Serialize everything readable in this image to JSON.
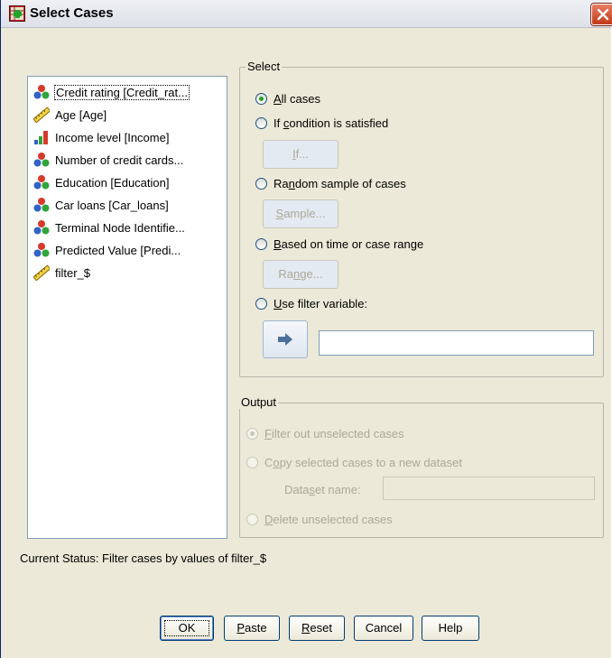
{
  "window": {
    "title": "Select Cases"
  },
  "variables": [
    {
      "label": "Credit rating [Credit_rat...",
      "icon": "nominal-icon",
      "selected": true
    },
    {
      "label": "Age [Age]",
      "icon": "scale-ruler-icon"
    },
    {
      "label": "Income level [Income]",
      "icon": "ordinal-bar-icon"
    },
    {
      "label": "Number of credit cards...",
      "icon": "nominal-icon"
    },
    {
      "label": "Education [Education]",
      "icon": "nominal-icon"
    },
    {
      "label": "Car loans [Car_loans]",
      "icon": "nominal-icon"
    },
    {
      "label": "Terminal Node Identifie...",
      "icon": "nominal-icon"
    },
    {
      "label": "Predicted Value [Predi...",
      "icon": "nominal-icon"
    },
    {
      "label": "filter_$",
      "icon": "scale-ruler-icon"
    }
  ],
  "select_group": {
    "legend": "Select",
    "all_cases": {
      "mnemonic": "A",
      "rest": "ll cases",
      "checked": true
    },
    "if_condition": {
      "pre": "If ",
      "mnemonic": "c",
      "rest": "ondition is satisfied"
    },
    "if_button": {
      "pre": "",
      "mnemonic": "I",
      "rest": "f..."
    },
    "random_sample": {
      "pre": "Ra",
      "mnemonic": "n",
      "rest": "dom sample of cases"
    },
    "sample_button": {
      "pre": "",
      "mnemonic": "S",
      "rest": "ample..."
    },
    "time_range": {
      "pre": "",
      "mnemonic": "B",
      "rest": "ased on time or case range"
    },
    "range_button": {
      "pre": "Ra",
      "mnemonic": "n",
      "rest": "ge..."
    },
    "filter_variable": {
      "pre": "",
      "mnemonic": "U",
      "rest": "se filter variable:"
    },
    "filter_value": ""
  },
  "output_group": {
    "legend": "Output",
    "filter_out": {
      "pre": "",
      "mnemonic": "F",
      "rest": "ilter out unselected cases",
      "checked": true
    },
    "copy_selected": {
      "pre": "C",
      "mnemonic": "o",
      "rest": "py selected cases to a new dataset"
    },
    "dataset_name": {
      "pre": "Data",
      "mnemonic": "s",
      "rest": "et name:",
      "value": ""
    },
    "delete_unselected": {
      "pre": "",
      "mnemonic": "D",
      "rest": "elete unselected cases"
    }
  },
  "status": "Current Status: Filter cases by values of filter_$",
  "buttons": {
    "ok": "OK",
    "paste": {
      "mnemonic": "P",
      "rest": "aste"
    },
    "reset": {
      "mnemonic": "R",
      "rest": "eset"
    },
    "cancel": "Cancel",
    "help": "Help"
  },
  "colors": {
    "selected_radio": "#21a121",
    "dialog_bg": "#ece9d8"
  }
}
